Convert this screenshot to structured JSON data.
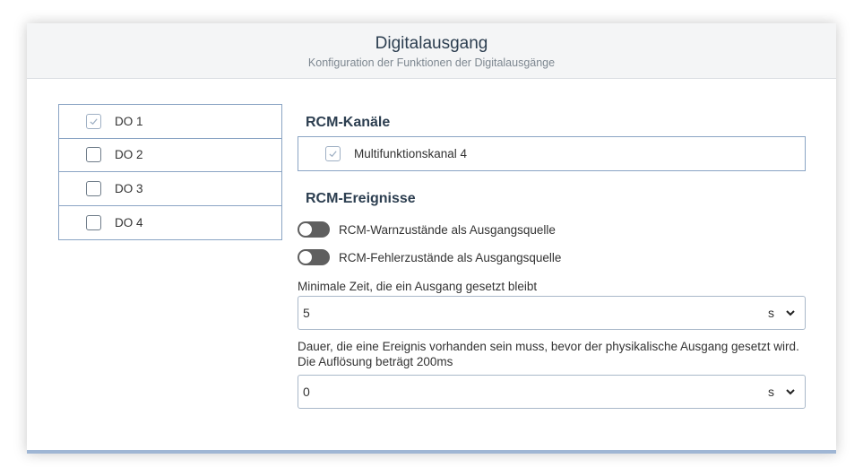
{
  "header": {
    "title": "Digitalausgang",
    "subtitle": "Konfiguration der Funktionen der Digitalausgänge"
  },
  "outputs": [
    {
      "label": "DO 1",
      "checked": true
    },
    {
      "label": "DO 2",
      "checked": false
    },
    {
      "label": "DO 3",
      "checked": false
    },
    {
      "label": "DO 4",
      "checked": false
    }
  ],
  "rcm_channels": {
    "title": "RCM-Kanäle",
    "channel_label": "Multifunktionskanal 4",
    "channel_checked": true
  },
  "rcm_events": {
    "title": "RCM-Ereignisse",
    "warn_toggle_label": "RCM-Warnzustände als Ausgangsquelle",
    "warn_toggle_on": false,
    "error_toggle_label": "RCM-Fehlerzustände als Ausgangsquelle",
    "error_toggle_on": false
  },
  "min_time": {
    "label": "Minimale Zeit, die ein Ausgang gesetzt bleibt",
    "value": "5",
    "unit": "s"
  },
  "duration": {
    "label": "Dauer, die eine Ereignis vorhanden sein muss, bevor der physikalische Ausgang gesetzt wird. Die Auflösung beträgt 200ms",
    "value": "0",
    "unit": "s"
  },
  "colors": {
    "accent_border": "#8aa4c4",
    "bottom_bar": "#9fb6d4",
    "toggle_off": "#5f5f5f"
  },
  "icons": {
    "checkbox_checked": "checkmark-icon",
    "select_arrow": "chevron-down-icon"
  }
}
